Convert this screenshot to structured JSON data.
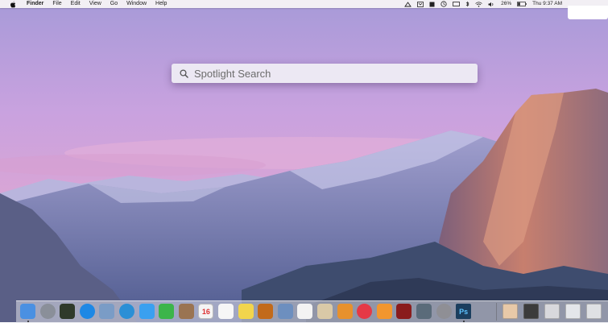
{
  "menubar": {
    "apple_icon": "apple-logo-icon",
    "app_name": "Finder",
    "items": [
      "File",
      "Edit",
      "View",
      "Go",
      "Window",
      "Help"
    ],
    "status": {
      "battery_percent": "26%",
      "clock": "Thu 9:37 AM"
    }
  },
  "spotlight": {
    "placeholder": "Spotlight Search",
    "icon": "magnifier-icon"
  },
  "dock": {
    "apps": [
      {
        "name": "finder-icon",
        "color": "#4a90e2",
        "running": true
      },
      {
        "name": "launchpad-icon",
        "color": "#8a8f99",
        "running": false
      },
      {
        "name": "mission-control-icon",
        "color": "#2f3a2a",
        "running": false
      },
      {
        "name": "app-store-icon",
        "color": "#1e88e5",
        "running": false
      },
      {
        "name": "preview-icon",
        "color": "#7a9cc6",
        "running": false
      },
      {
        "name": "safari-icon",
        "color": "#2b8fd6",
        "running": false
      },
      {
        "name": "messages-icon",
        "color": "#3aa0f0",
        "running": false
      },
      {
        "name": "facetime-icon",
        "color": "#3cb54a",
        "running": false
      },
      {
        "name": "contacts-icon",
        "color": "#9a7452",
        "running": false
      },
      {
        "name": "calendar-icon",
        "color": "#f4f4f4",
        "running": false
      },
      {
        "name": "reminders-icon",
        "color": "#f6f6f6",
        "running": false
      },
      {
        "name": "notes-icon",
        "color": "#f2d54c",
        "running": false
      },
      {
        "name": "garageband-icon",
        "color": "#c26a1a",
        "running": false
      },
      {
        "name": "iphoto-icon",
        "color": "#6d8fbf",
        "running": false
      },
      {
        "name": "textedit-icon",
        "color": "#f3f3f3",
        "running": false
      },
      {
        "name": "script-editor-icon",
        "color": "#d9c9a7",
        "running": false
      },
      {
        "name": "ibooks-icon",
        "color": "#e7912d",
        "running": false
      },
      {
        "name": "itunes-icon",
        "color": "#e53946",
        "running": false
      },
      {
        "name": "ibooks-store-icon",
        "color": "#f2962f",
        "running": false
      },
      {
        "name": "photo-booth-icon",
        "color": "#8a1c1c",
        "running": false
      },
      {
        "name": "image-capture-icon",
        "color": "#5a6b7a",
        "running": false
      },
      {
        "name": "system-preferences-icon",
        "color": "#8f8f95",
        "running": false
      },
      {
        "name": "photoshop-icon",
        "color": "#1b3e5e",
        "running": true
      }
    ],
    "stack_items": [
      {
        "name": "downloads-stack-icon",
        "color": "#e8c9a8"
      },
      {
        "name": "documents-stack-icon",
        "color": "#3b3b3b"
      },
      {
        "name": "folder-stack-icon",
        "color": "#d8d8dc"
      },
      {
        "name": "files-stack-icon",
        "color": "#e4e6ea"
      },
      {
        "name": "trash-icon",
        "color": "#dfe1e4"
      }
    ],
    "photoshop_label": "Ps",
    "calendar_day": "16"
  }
}
